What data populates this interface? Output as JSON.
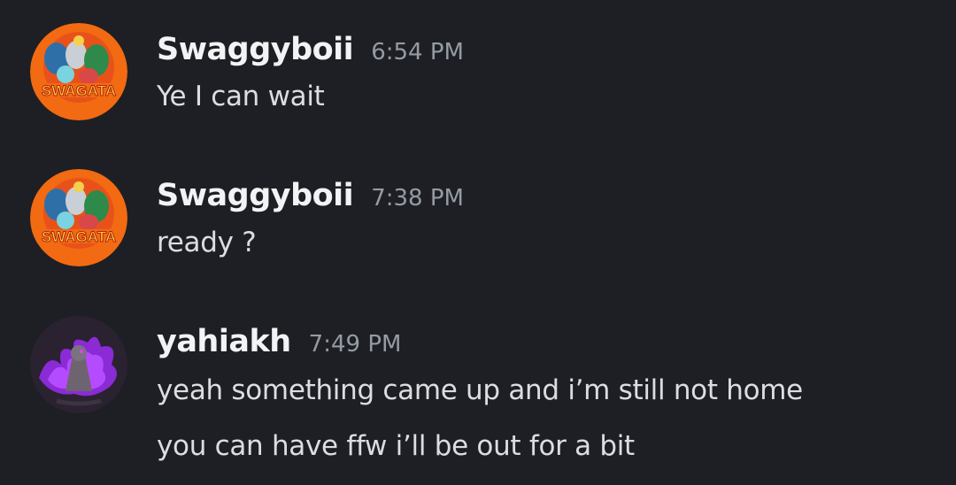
{
  "messages": [
    {
      "author": "Swaggyboii",
      "time": "6:54 PM",
      "avatar_icon": "swagata-avatar",
      "avatar_text": "SWAGATA",
      "lines": [
        "Ye I can wait"
      ]
    },
    {
      "author": "Swaggyboii",
      "time": "7:38 PM",
      "avatar_icon": "swagata-avatar",
      "avatar_text": "SWAGATA",
      "lines": [
        "ready ?"
      ]
    },
    {
      "author": "yahiakh",
      "time": "7:49 PM",
      "avatar_icon": "purple-dragon-avatar",
      "lines": [
        "yeah something came up and i’m still not home",
        "you can have ffw i’ll be out for a bit"
      ]
    }
  ],
  "colors": {
    "background": "#1e1f24",
    "username": "#f2f3f5",
    "timestamp": "#949ba4",
    "message_text": "#dbdee1"
  }
}
